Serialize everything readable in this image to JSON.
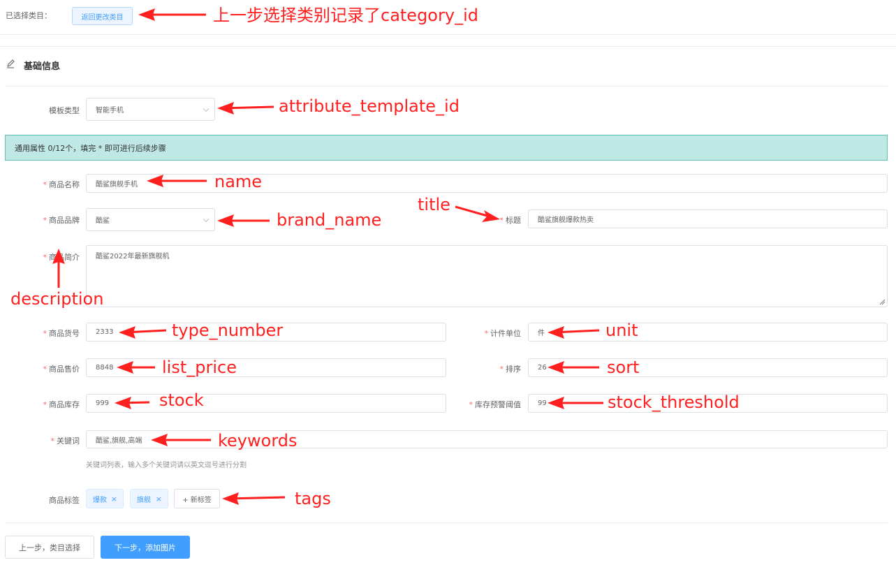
{
  "top": {
    "label": "已选择类目：",
    "change_button": "返回更改类目"
  },
  "section": {
    "title": "基础信息"
  },
  "template": {
    "label": "模板类型",
    "value": "智能手机"
  },
  "notice": {
    "text": "通用属性 0/12个，填完 * 即可进行后续步骤"
  },
  "form": {
    "required_mark": "*",
    "name": {
      "label": "商品名称",
      "value": "酷鲨旗舰手机"
    },
    "brand": {
      "label": "商品品牌",
      "value": "酷鲨"
    },
    "title": {
      "label": "标题",
      "value": "酷鲨旗舰爆款热卖"
    },
    "description": {
      "label": "商品简介",
      "value": "酷鲨2022年最新旗舰机"
    },
    "type_number": {
      "label": "商品货号",
      "value": "2333"
    },
    "unit": {
      "label": "计件单位",
      "value": "件"
    },
    "list_price": {
      "label": "商品售价",
      "value": "8848"
    },
    "sort": {
      "label": "排序",
      "value": "26"
    },
    "stock": {
      "label": "商品库存",
      "value": "999"
    },
    "stock_threshold": {
      "label": "库存预警阈值",
      "value": "99"
    },
    "keywords": {
      "label": "关键词",
      "value": "酷鲨,旗舰,高端",
      "hint": "关键词列表，输入多个关键词请以英文逗号进行分割"
    },
    "tags": {
      "label": "商品标签",
      "items": [
        "爆款",
        "旗舰"
      ],
      "close": "×",
      "new_tag": "+ 新标签"
    }
  },
  "footer": {
    "prev_button": "上一步，类目选择",
    "next_button": "下一步，添加图片"
  },
  "annotations": {
    "category_id": "上一步选择类别记录了category_id",
    "attribute_template_id": "attribute_template_id",
    "name": "name",
    "title": "title",
    "brand_name": "brand_name",
    "description": "description",
    "type_number": "type_number",
    "unit": "unit",
    "list_price": "list_price",
    "sort": "sort",
    "stock": "stock",
    "stock_threshold": "stock_threshold",
    "keywords": "keywords",
    "tags": "tags"
  },
  "colors": {
    "annotation_red": "#ff1f1f",
    "primary_blue": "#409eff",
    "notice_bg": "#bfe7e4",
    "notice_border": "#5fbfb6",
    "required_star": "#f56c6c"
  },
  "icons": {
    "section": "edit-pencil-icon",
    "select": "chevron-down-icon",
    "tag_close": "close-icon"
  }
}
